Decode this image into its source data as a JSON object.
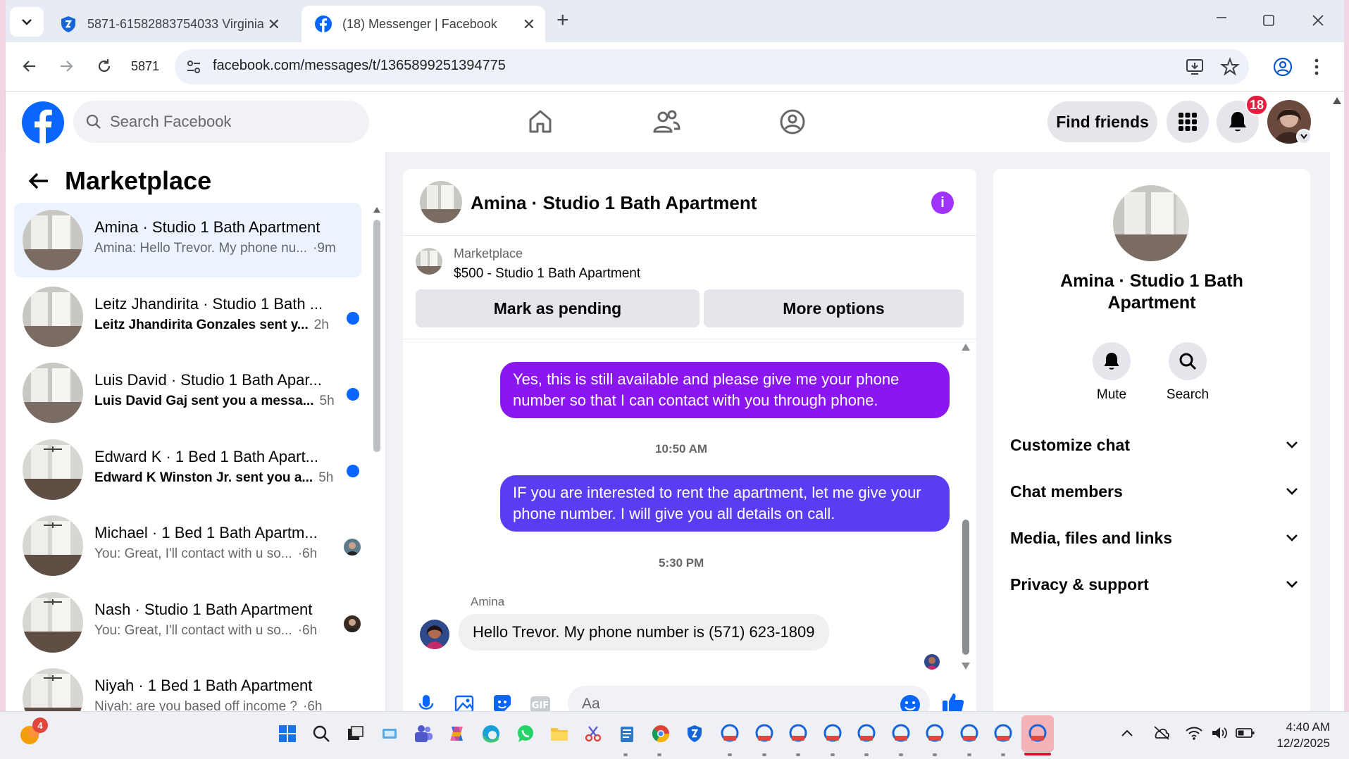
{
  "browser": {
    "tabs": [
      {
        "title": "5871-61582883754033 Virginia",
        "close": "✕"
      },
      {
        "title": "(18) Messenger | Facebook",
        "close": "✕"
      }
    ],
    "new_tab": "+",
    "profile_label": "5871",
    "url": "facebook.com/messages/t/1365899251394775"
  },
  "fb": {
    "search_placeholder": "Search Facebook",
    "find_friends": "Find friends",
    "notification_count": "18"
  },
  "left": {
    "title": "Marketplace",
    "conversations": [
      {
        "title": "Amina · Studio 1 Bath Apartment",
        "preview": "Amina: Hello Trevor. My phone nu...",
        "time": "·9m",
        "unread": false,
        "selected": true
      },
      {
        "title": "Leitz Jhandirita · Studio 1 Bath ...",
        "preview": "Leitz Jhandirita Gonzales sent y...",
        "time": "2h",
        "unread": true
      },
      {
        "title": "Luis David · Studio 1 Bath Apar...",
        "preview": "Luis David Gaj sent you a messa...",
        "time": "5h",
        "unread": true
      },
      {
        "title": "Edward K · 1 Bed 1 Bath Apart...",
        "preview": "Edward K Winston Jr. sent you a...",
        "time": "5h",
        "unread": true
      },
      {
        "title": "Michael · 1 Bed 1 Bath Apartm...",
        "preview": "You: Great, I'll contact with u so...",
        "time": "·6h",
        "unread": false
      },
      {
        "title": "Nash · Studio 1 Bath Apartment",
        "preview": "You: Great, I'll contact with u so...",
        "time": "·6h",
        "unread": false
      },
      {
        "title": "Niyah · 1 Bed 1 Bath Apartment",
        "preview": "Niyah: are you based off income ?",
        "time": "·6h",
        "unread": false
      }
    ]
  },
  "chat": {
    "title": "Amina · Studio 1 Bath Apartment",
    "info_icon": "i",
    "marketplace_label": "Marketplace",
    "listing": "$500 - Studio 1 Bath Apartment",
    "mark_pending": "Mark as pending",
    "more_options": "More options",
    "messages": [
      {
        "type": "out",
        "text": "Yes, this is still available and please give me your phone number so that I can contact with you through phone.",
        "color": "#8a16f0"
      },
      {
        "type": "time",
        "text": "10:50 AM"
      },
      {
        "type": "out",
        "text": "IF you are interested to rent the apartment, let me give your phone number. I will give you all details on call.",
        "color": "#5a3cf2"
      },
      {
        "type": "time",
        "text": "5:30 PM"
      },
      {
        "type": "sender",
        "text": "Amina"
      },
      {
        "type": "in",
        "text": "Hello Trevor. My phone number is (571) 623-1809"
      }
    ],
    "composer_placeholder": "Aa"
  },
  "right": {
    "name": "Amina · Studio 1 Bath Apartment",
    "mute": "Mute",
    "search": "Search",
    "sections": [
      "Customize chat",
      "Chat members",
      "Media, files and links",
      "Privacy & support"
    ]
  },
  "taskbar": {
    "badge": "4",
    "time": "4:40 AM",
    "date": "12/2/2025"
  },
  "colors": {
    "fb_blue": "#0866ff",
    "accent_purple": "#a033ff"
  }
}
